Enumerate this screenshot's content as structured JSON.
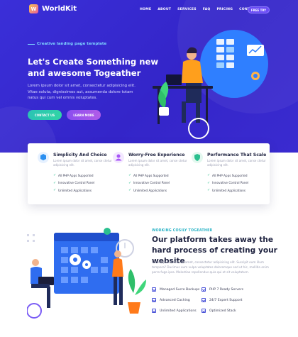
{
  "brand": {
    "name": "WorldKit",
    "logo_glyph": "W"
  },
  "nav": {
    "items": [
      "HOME",
      "ABOUT",
      "SERVICES",
      "FAQ",
      "PRICING",
      "CONTACT"
    ],
    "cta": "FREE TRY"
  },
  "hero": {
    "eyebrow": "Creative landing page template",
    "title": "Let's Create Something new and awesome Togeather",
    "text": "Lorem ipsum dolor sit amet, consectetur adipisicing elit. Vitae soluta, dignissimos aut, assumenda dolore totam natus qui cum vel omnis voluptates.",
    "btn_contact": "CONTACT US",
    "btn_learn": "LEARN MORE"
  },
  "features": [
    {
      "title": "Simplicity And Choice",
      "text": "Lorem ipsum dolor sit amet, conse ctetur adipisicing elit.",
      "items": [
        "All PHP Apps Supported",
        "Innovative Control Panel",
        "Unlimited Applications"
      ],
      "icon": "cube-icon",
      "color": "#2b8ff0"
    },
    {
      "title": "Worry-Free Experience",
      "text": "Lorem ipsum dolor sit amet, conse ctetur adipisicing elit.",
      "items": [
        "All PHP Apps Supported",
        "Innovative Control Panel",
        "Unlimited Applications"
      ],
      "icon": "user-icon",
      "color": "#a855f7"
    },
    {
      "title": "Performance That Scale",
      "text": "Lorem ipsum dolor sit amet, conse ctetur adipisicing elit.",
      "items": [
        "All PHP Apps Supported",
        "Innovative Control Panel",
        "Unlimited Applications"
      ],
      "icon": "shield-icon",
      "color": "#2bc08f"
    }
  ],
  "section2": {
    "eyebrow": "WORKING COSILY TOGEATHER",
    "title": "Our platform takes away the hard process of creating your website",
    "text": "Lorem ipsum dolor sit amet, consectetur adipisicing elit. Suscipit eum illum tempora? Ducimus eum vulpa voluptates doloremque sed ut hic, mollitia enim porro fuga ipsa. Molestiae repellendus quia qui et sit voluptatum.",
    "items": [
      "Managed Sucre Backups",
      "PHP 7 Ready Servers",
      "Advanced Caching",
      "24/7 Expert Support",
      "Unlimited Applications",
      "Optimized Stack"
    ]
  },
  "colors": {
    "hero_bg": "#3425c9",
    "accent_teal": "#2bc3b4",
    "accent_purple": "#8a4df0"
  }
}
